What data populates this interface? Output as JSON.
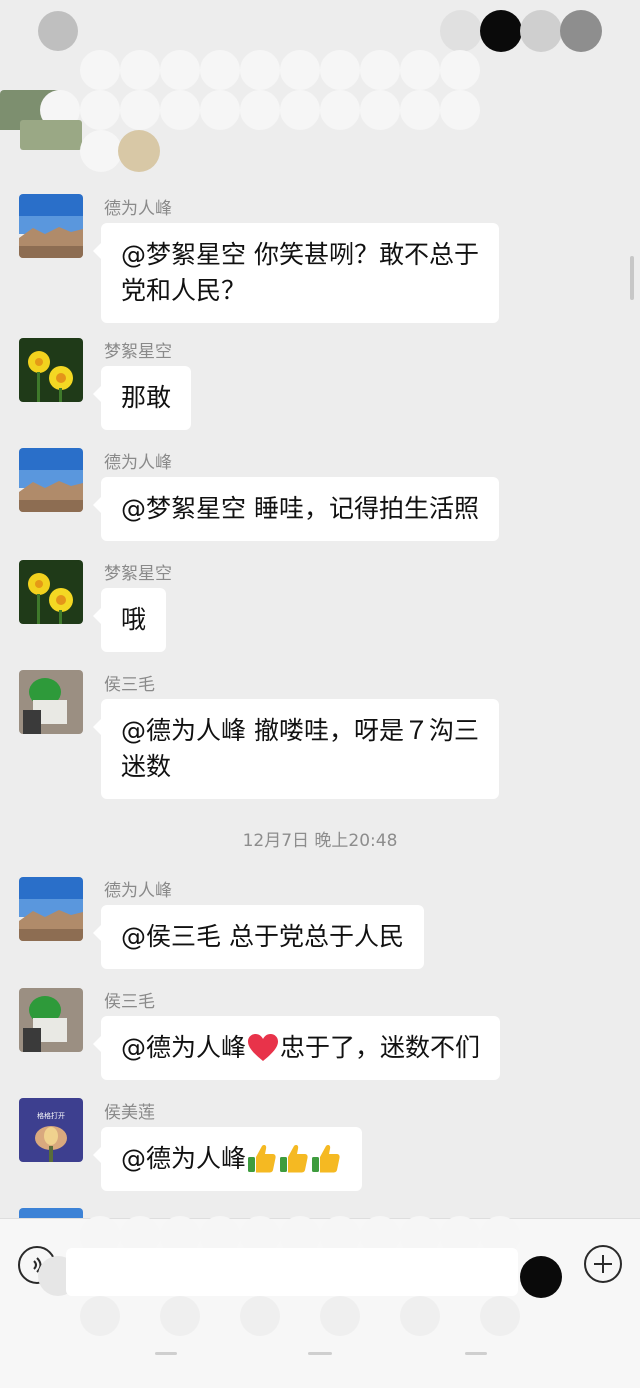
{
  "messages": [
    {
      "sender": "德为人峰",
      "text_lines": [
        "@梦絮星空  你笑甚咧？敢不总于",
        "党和人民？"
      ],
      "avatar": "sky-landscape"
    },
    {
      "sender": "梦絮星空",
      "text_lines": [
        "那敢"
      ],
      "avatar": "daffodil-flowers"
    },
    {
      "sender": "德为人峰",
      "text_lines": [
        "@梦絮星空  睡哇，记得拍生活照"
      ],
      "avatar": "sky-landscape"
    },
    {
      "sender": "梦絮星空",
      "text_lines": [
        "哦"
      ],
      "avatar": "daffodil-flowers"
    },
    {
      "sender": "侯三毛",
      "text_lines": [
        "@德为人峰  撤喽哇，呀是７沟三",
        "迷数"
      ],
      "avatar": "green-cabbage-photo"
    },
    {
      "sender": "德为人峰",
      "text_lines": [
        "@侯三毛  总于党总于人民"
      ],
      "avatar": "sky-landscape"
    },
    {
      "sender": "侯三毛",
      "text_lines": [
        "@德为人峰 ",
        "忠于了，迷数不们"
      ],
      "avatar": "green-cabbage-photo"
    },
    {
      "sender": "侯美莲",
      "text_lines": [
        "@德为人峰 "
      ],
      "avatar": "lotus-flower-image"
    }
  ],
  "timestamp": "12月7日 晚上20:48",
  "avatar_text": {
    "lotus": "格格打开"
  },
  "icons": {
    "heart": "red-heart-emoji",
    "thumbs": "thumbs-up-emoji",
    "voice": "voice-input-icon",
    "plus": "plus-icon"
  },
  "colors": {
    "background": "#ededed",
    "bubble": "#ffffff",
    "sender": "#8a8a8a",
    "heart": "#e8334a",
    "thumb": "#f5b922"
  }
}
